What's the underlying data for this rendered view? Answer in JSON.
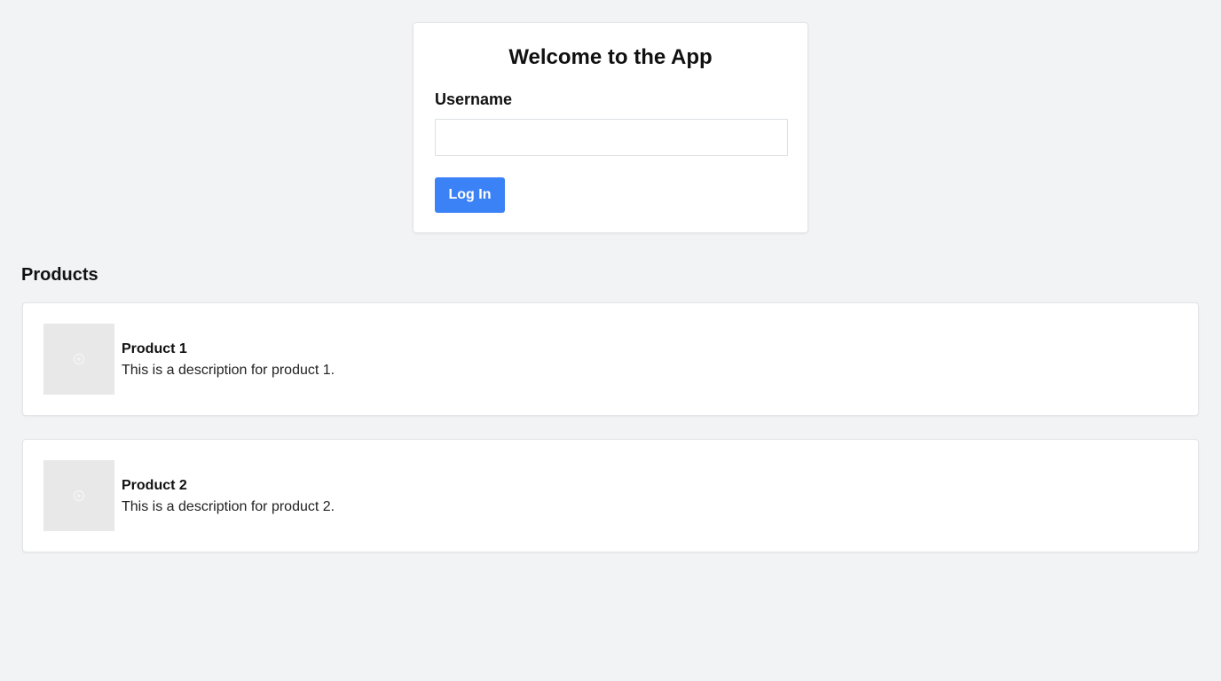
{
  "login": {
    "title": "Welcome to the App",
    "username_label": "Username",
    "username_value": "",
    "username_placeholder": "",
    "button_label": "Log In",
    "button_color": "#3b82f6"
  },
  "products": {
    "heading": "Products",
    "items": [
      {
        "name": "Product 1",
        "description": "This is a description for product 1.",
        "image_icon": "image-placeholder-icon"
      },
      {
        "name": "Product 2",
        "description": "This is a description for product 2.",
        "image_icon": "image-placeholder-icon"
      }
    ]
  },
  "colors": {
    "background": "#f2f3f5",
    "card": "#ffffff",
    "accent": "#3b82f6"
  }
}
